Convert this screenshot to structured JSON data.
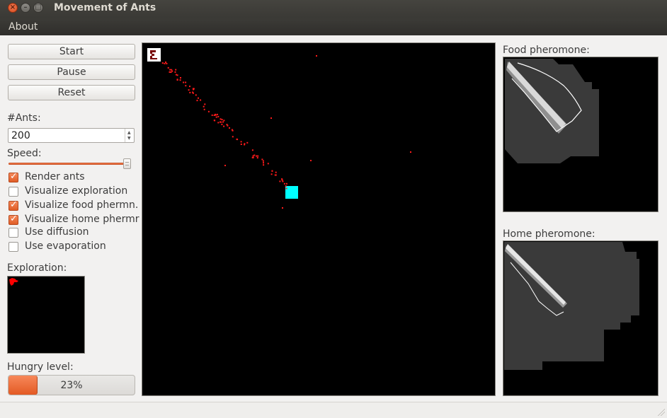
{
  "window": {
    "title": "Movement of Ants"
  },
  "menu": {
    "about": "About"
  },
  "controls": {
    "start": "Start",
    "pause": "Pause",
    "reset": "Reset",
    "ants_label": "#Ants:",
    "ants_value": "200",
    "speed_label": "Speed:",
    "speed_level": 0.97
  },
  "options": [
    {
      "label": "Render ants",
      "checked": true
    },
    {
      "label": "Visualize exploration",
      "checked": false
    },
    {
      "label": "Visualize food phermn.",
      "checked": true
    },
    {
      "label": "Visualize home phermr",
      "checked": true
    },
    {
      "label": "Use diffusion",
      "checked": false
    },
    {
      "label": "Use evaporation",
      "checked": false
    }
  ],
  "exploration": {
    "label": "Exploration:"
  },
  "hunger": {
    "label": "Hungry level:",
    "value": 23,
    "text": "23%"
  },
  "food_pheromone": {
    "label": "Food pheromone:"
  },
  "home_pheromone": {
    "label": "Home pheromone:"
  },
  "colors": {
    "accent": "#f07746",
    "ant": "#ff1a1a",
    "food": "#00ffff",
    "nest": "#ffffff"
  }
}
